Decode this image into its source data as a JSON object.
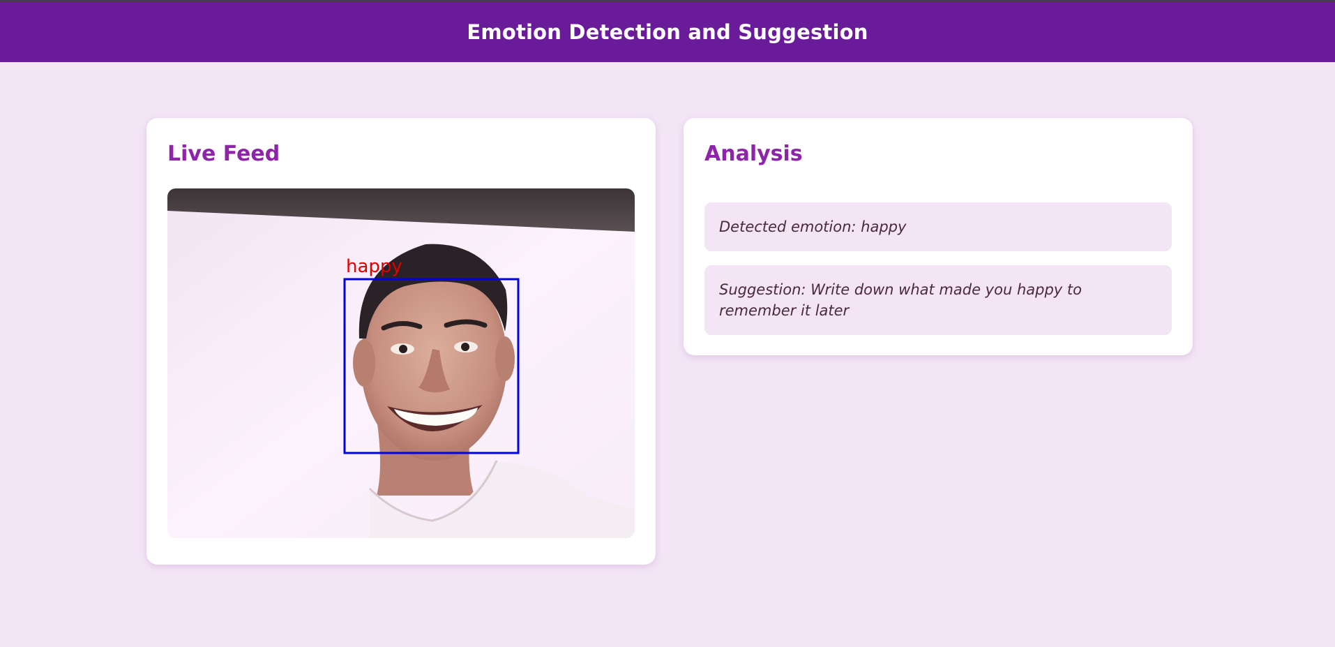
{
  "header": {
    "title": "Emotion Detection and Suggestion",
    "background_color": "#6a1b9a"
  },
  "live_feed": {
    "title": "Live Feed",
    "face_label": "happy",
    "face_box_color": "#0000e0",
    "face_label_color": "#e00000"
  },
  "analysis": {
    "title": "Analysis",
    "detected_emotion": "Detected emotion: happy",
    "suggestion": "Suggestion: Write down what made you happy to remember it later"
  },
  "colors": {
    "accent": "#8e24aa",
    "page_background": "#f3e5f5",
    "info_box_background": "#f3e5f5"
  }
}
